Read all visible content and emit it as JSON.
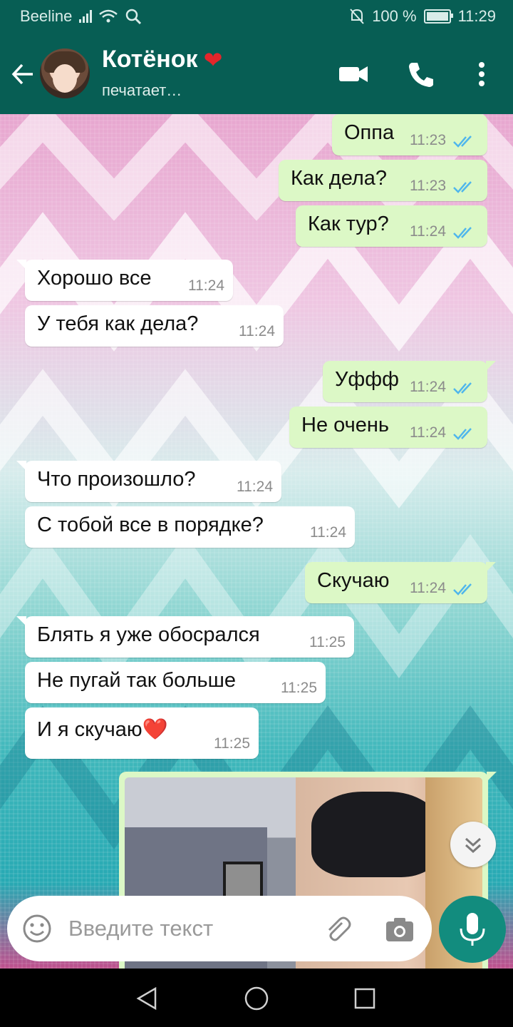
{
  "status_bar": {
    "carrier": "Beeline",
    "battery": "100 %",
    "time": "11:29",
    "icons": [
      "signal-icon",
      "wifi-icon",
      "search-icon",
      "mute-bell-icon",
      "battery-icon"
    ]
  },
  "header": {
    "contact_name": "Котёнок",
    "status": "печатает…",
    "icons": [
      "back-arrow-icon",
      "video-call-icon",
      "phone-icon",
      "more-vert-icon"
    ],
    "heart_color": "#e3262b"
  },
  "messages": [
    {
      "dir": "out",
      "text": "Оппа",
      "time": "11:23"
    },
    {
      "dir": "out",
      "text": "Как дела?",
      "time": "11:23"
    },
    {
      "dir": "out",
      "text": "Как тур?",
      "time": "11:24"
    },
    {
      "dir": "in",
      "text": "Хорошо все",
      "time": "11:24"
    },
    {
      "dir": "in",
      "text": "У тебя как дела?",
      "time": "11:24"
    },
    {
      "dir": "out",
      "text": "Уффф",
      "time": "11:24"
    },
    {
      "dir": "out",
      "text": "Не очень",
      "time": "11:24"
    },
    {
      "dir": "in",
      "text": "Что произошло?",
      "time": "11:24"
    },
    {
      "dir": "in",
      "text": "С тобой все в порядке?",
      "time": "11:24"
    },
    {
      "dir": "out",
      "text": "Скучаю",
      "time": "11:24"
    },
    {
      "dir": "in",
      "text": "Блять я уже обосрался",
      "time": "11:25"
    },
    {
      "dir": "in",
      "text": "Не пугай так больше",
      "time": "11:25"
    },
    {
      "dir": "in",
      "text": "И я скучаю❤️",
      "time": "11:25"
    }
  ],
  "composer": {
    "placeholder": "Введите текст",
    "icons": [
      "emoji-icon",
      "attach-icon",
      "camera-icon",
      "mic-icon"
    ]
  },
  "colors": {
    "header": "#075e54",
    "outgoing_bubble": "#dcf8c6",
    "incoming_bubble": "#ffffff",
    "read_ticks": "#4fb6ec",
    "fab": "#128c7e"
  }
}
